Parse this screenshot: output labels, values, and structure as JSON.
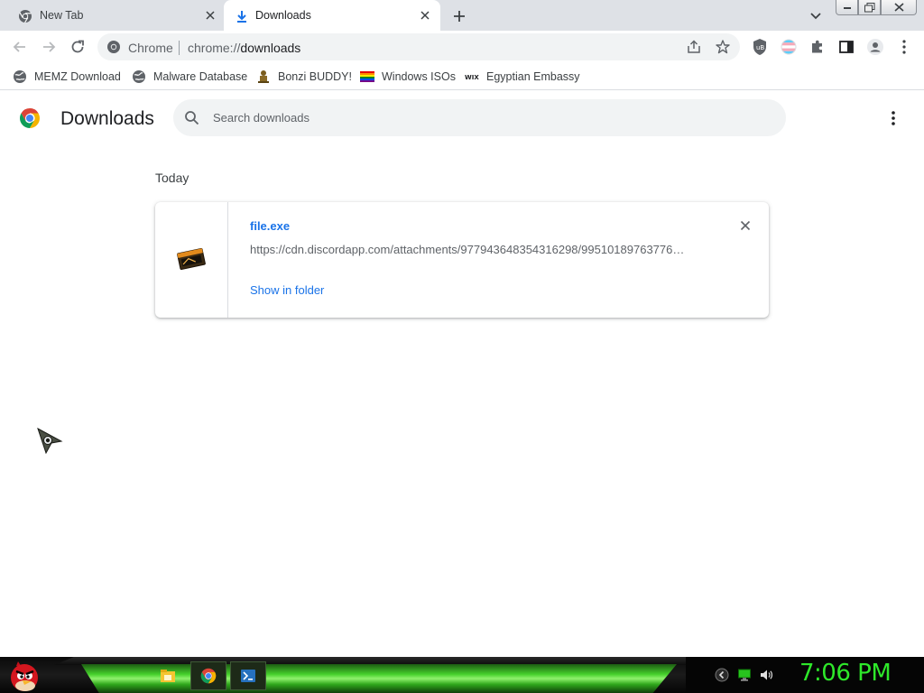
{
  "tabs": [
    {
      "label": "New Tab",
      "icon": "chrome-icon"
    },
    {
      "label": "Downloads",
      "icon": "download-icon",
      "active": true
    }
  ],
  "omnibox": {
    "site_chip": "Chrome",
    "url_scheme": "chrome://",
    "url_host": "downloads"
  },
  "bookmarks": [
    {
      "label": "MEMZ Download",
      "icon": "globe-icon"
    },
    {
      "label": "Malware Database",
      "icon": "globe-icon"
    },
    {
      "label": "Bonzi BUDDY!",
      "icon": "bonzi-icon"
    },
    {
      "label": "Windows ISOs",
      "icon": "rainbow-flag-icon"
    },
    {
      "label": "Egyptian Embassy",
      "icon": "wix-icon"
    }
  ],
  "page": {
    "title": "Downloads",
    "search_placeholder": "Search downloads",
    "date_heading": "Today"
  },
  "download": {
    "file_name": "file.exe",
    "url": "https://cdn.discordapp.com/attachments/977943648354316298/99510189763776…",
    "action": "Show in folder"
  },
  "taskbar": {
    "clock": "7:06 PM",
    "apps": [
      "file-explorer-icon",
      "chrome-icon",
      "powershell-icon"
    ]
  },
  "colors": {
    "accent": "#1a73e8",
    "tabstrip": "#dee1e6",
    "clock": "#2ee82a"
  }
}
